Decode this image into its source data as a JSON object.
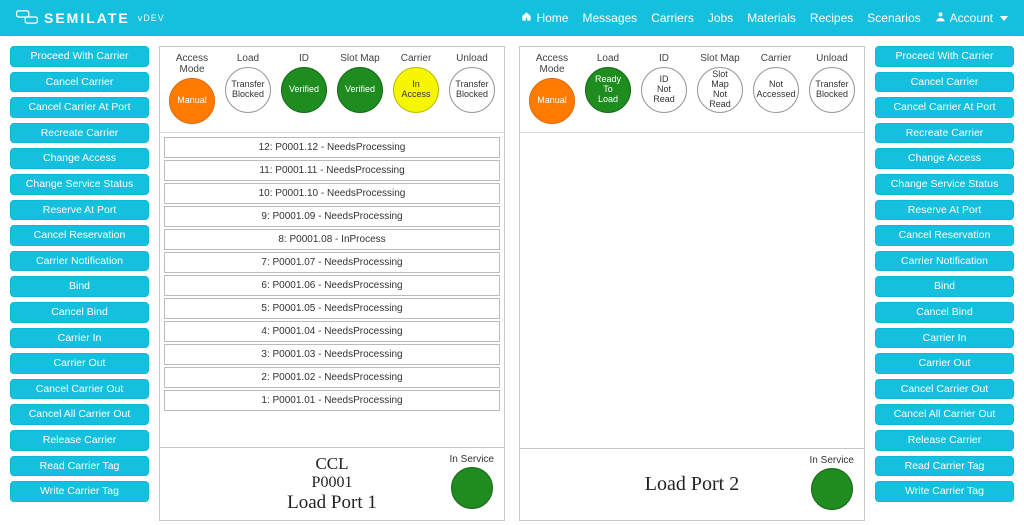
{
  "brand": {
    "name": "SEMILATE",
    "tag": "vDEV"
  },
  "nav": {
    "home": "Home",
    "messages": "Messages",
    "carriers": "Carriers",
    "jobs": "Jobs",
    "materials": "Materials",
    "recipes": "Recipes",
    "scenarios": "Scenarios",
    "account": "Account"
  },
  "side_buttons": [
    "Proceed With Carrier",
    "Cancel Carrier",
    "Cancel Carrier At Port",
    "Recreate Carrier",
    "Change Access",
    "Change Service Status",
    "Reserve At Port",
    "Cancel Reservation",
    "Carrier Notification",
    "Bind",
    "Cancel Bind",
    "Carrier In",
    "Carrier Out",
    "Cancel Carrier Out",
    "Cancel All Carrier Out",
    "Release Carrier",
    "Read Carrier Tag",
    "Write Carrier Tag"
  ],
  "status_headers": [
    "Access Mode",
    "Load",
    "ID",
    "Slot Map",
    "Carrier",
    "Unload"
  ],
  "port1": {
    "statuses": [
      {
        "text": "Manual",
        "style": "orange"
      },
      {
        "text": "Transfer Blocked",
        "style": "plain"
      },
      {
        "text": "Verified",
        "style": "green"
      },
      {
        "text": "Verified",
        "style": "green"
      },
      {
        "text": "In Access",
        "style": "yellow"
      },
      {
        "text": "Transfer Blocked",
        "style": "plain"
      }
    ],
    "slots": [
      "12: P0001.12 - NeedsProcessing",
      "11: P0001.11 - NeedsProcessing",
      "10: P0001.10 - NeedsProcessing",
      "9: P0001.09 - NeedsProcessing",
      "8: P0001.08 - InProcess",
      "7: P0001.07 - NeedsProcessing",
      "6: P0001.06 - NeedsProcessing",
      "5: P0001.05 - NeedsProcessing",
      "4: P0001.04 - NeedsProcessing",
      "3: P0001.03 - NeedsProcessing",
      "2: P0001.02 - NeedsProcessing",
      "1: P0001.01 - NeedsProcessing"
    ],
    "footer": {
      "line1": "CCL",
      "line2": "P0001",
      "line3": "Load Port 1"
    },
    "service_label": "In Service"
  },
  "port2": {
    "statuses": [
      {
        "text": "Manual",
        "style": "orange"
      },
      {
        "text": "Ready To Load",
        "style": "green"
      },
      {
        "text": "ID Not Read",
        "style": "plain"
      },
      {
        "text": "Slot Map Not Read",
        "style": "plain"
      },
      {
        "text": "Not Accessed",
        "style": "plain"
      },
      {
        "text": "Transfer Blocked",
        "style": "plain"
      }
    ],
    "slots": [],
    "footer": {
      "single": "Load Port 2"
    },
    "service_label": "In Service"
  }
}
